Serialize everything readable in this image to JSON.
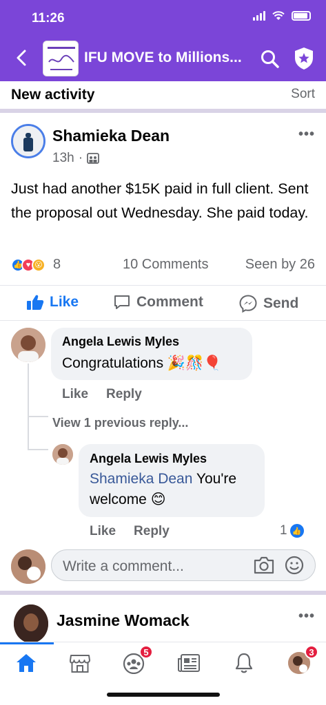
{
  "status_bar": {
    "time": "11:26"
  },
  "header": {
    "group_title": "IFU MOVE to Millions..."
  },
  "feed": {
    "section_title": "New activity",
    "sort_label": "Sort"
  },
  "post": {
    "author": "Shamieka Dean",
    "time": "13h",
    "separator": "·",
    "text": "Just had another $15K paid in full client. Sent the proposal out Wednesday. She paid today.",
    "reaction_count": "8",
    "comments_label": "10 Comments",
    "seen_label": "Seen by 26",
    "actions": {
      "like": "Like",
      "comment": "Comment",
      "send": "Send"
    }
  },
  "comments": [
    {
      "author": "Angela Lewis Myles",
      "text": "Congratulations 🎉🎊🎈",
      "like": "Like",
      "reply": "Reply"
    }
  ],
  "view_previous": "View 1 previous reply...",
  "reply": {
    "author": "Angela Lewis Myles",
    "mention": "Shamieka Dean",
    "text": " You're welcome 😊",
    "like": "Like",
    "reply": "Reply",
    "like_count": "1"
  },
  "composer": {
    "placeholder": "Write a comment..."
  },
  "next_post": {
    "author": "Jasmine Womack"
  },
  "tabs": {
    "groups_badge": "5",
    "menu_badge": "3"
  },
  "colors": {
    "header": "#7b45d8",
    "accent": "#1877f2",
    "badge": "#e41e3f"
  }
}
